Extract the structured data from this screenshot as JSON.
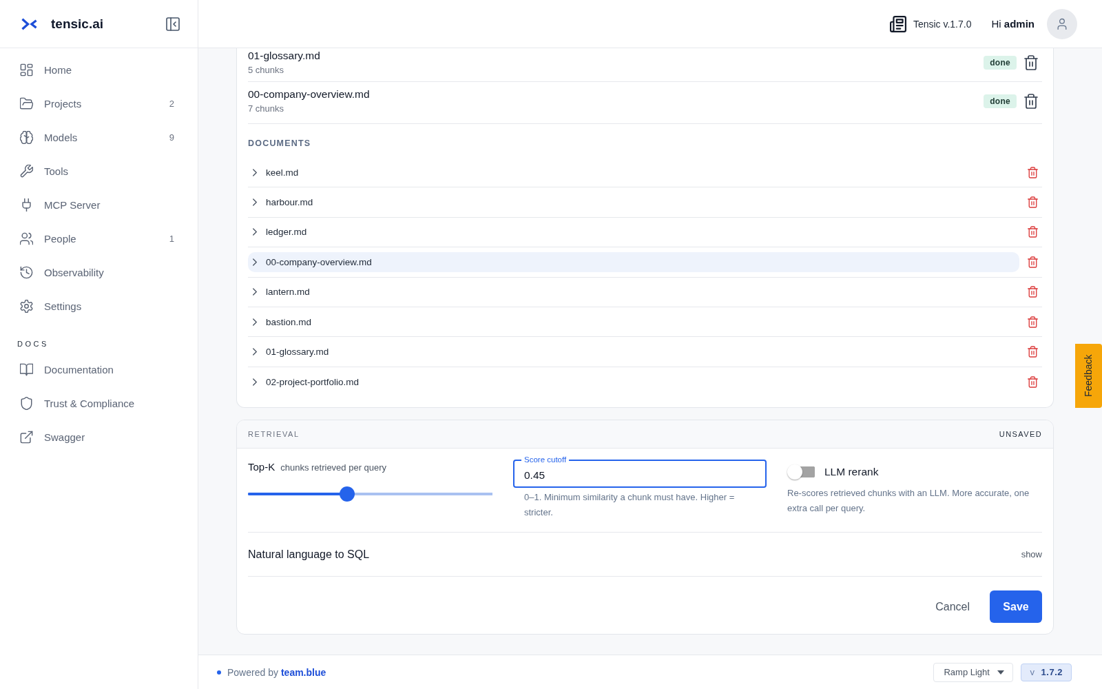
{
  "sidebar": {
    "brand": "tensic.ai",
    "nav": [
      {
        "label": "Home"
      },
      {
        "label": "Projects",
        "count": "2"
      },
      {
        "label": "Models",
        "count": "9"
      },
      {
        "label": "Tools"
      },
      {
        "label": "MCP Server"
      },
      {
        "label": "People",
        "count": "1"
      },
      {
        "label": "Observability"
      },
      {
        "label": "Settings"
      }
    ],
    "docs_heading": "DOCS",
    "docs": [
      {
        "label": "Documentation"
      },
      {
        "label": "Trust & Compliance"
      },
      {
        "label": "Swagger"
      }
    ]
  },
  "header": {
    "version": "Tensic v.1.7.0",
    "greeting": "Hi **admin**"
  },
  "uploads": [
    {
      "name": "01-glossary.md",
      "chunks": "5 chunks",
      "status": "done"
    },
    {
      "name": "00-company-overview.md",
      "chunks": "7 chunks",
      "status": "done"
    }
  ],
  "documents": {
    "heading": "DOCUMENTS",
    "items": [
      {
        "name": "keel.md",
        "expanded": false,
        "selected": false
      },
      {
        "name": "harbour.md",
        "expanded": false,
        "selected": false
      },
      {
        "name": "ledger.md",
        "expanded": false,
        "selected": false
      },
      {
        "name": "00-company-overview.md",
        "expanded": false,
        "selected": true
      },
      {
        "name": "lantern.md",
        "expanded": false,
        "selected": false
      },
      {
        "name": "bastion.md",
        "expanded": false,
        "selected": false
      },
      {
        "name": "01-glossary.md",
        "expanded": false,
        "selected": false
      },
      {
        "name": "02-project-portfolio.md",
        "expanded": false,
        "selected": false
      }
    ]
  },
  "retrieval": {
    "title": "RETRIEVAL",
    "status": "UNSAVED",
    "top_k": {
      "label": "Top-K",
      "hint": "chunks retrieved per query",
      "level": 0.4
    },
    "score_cutoff": {
      "label": "Score cutoff",
      "value": "0.45",
      "help": "0–1. Minimum similarity a chunk must have. Higher = stricter."
    },
    "rerank": {
      "label": "LLM rerank",
      "on": false,
      "help": "Re-scores retrieved chunks with an LLM. More accurate, one extra call per query."
    },
    "nl_sql": {
      "label": "Natural language to SQL",
      "action": "show"
    },
    "cancel": "Cancel",
    "save": "Save"
  },
  "footer": {
    "powered": "Powered by",
    "link": "team.blue",
    "theme": "Ramp Light",
    "version": "v **1.7.2**"
  },
  "feedback": "Feedback"
}
